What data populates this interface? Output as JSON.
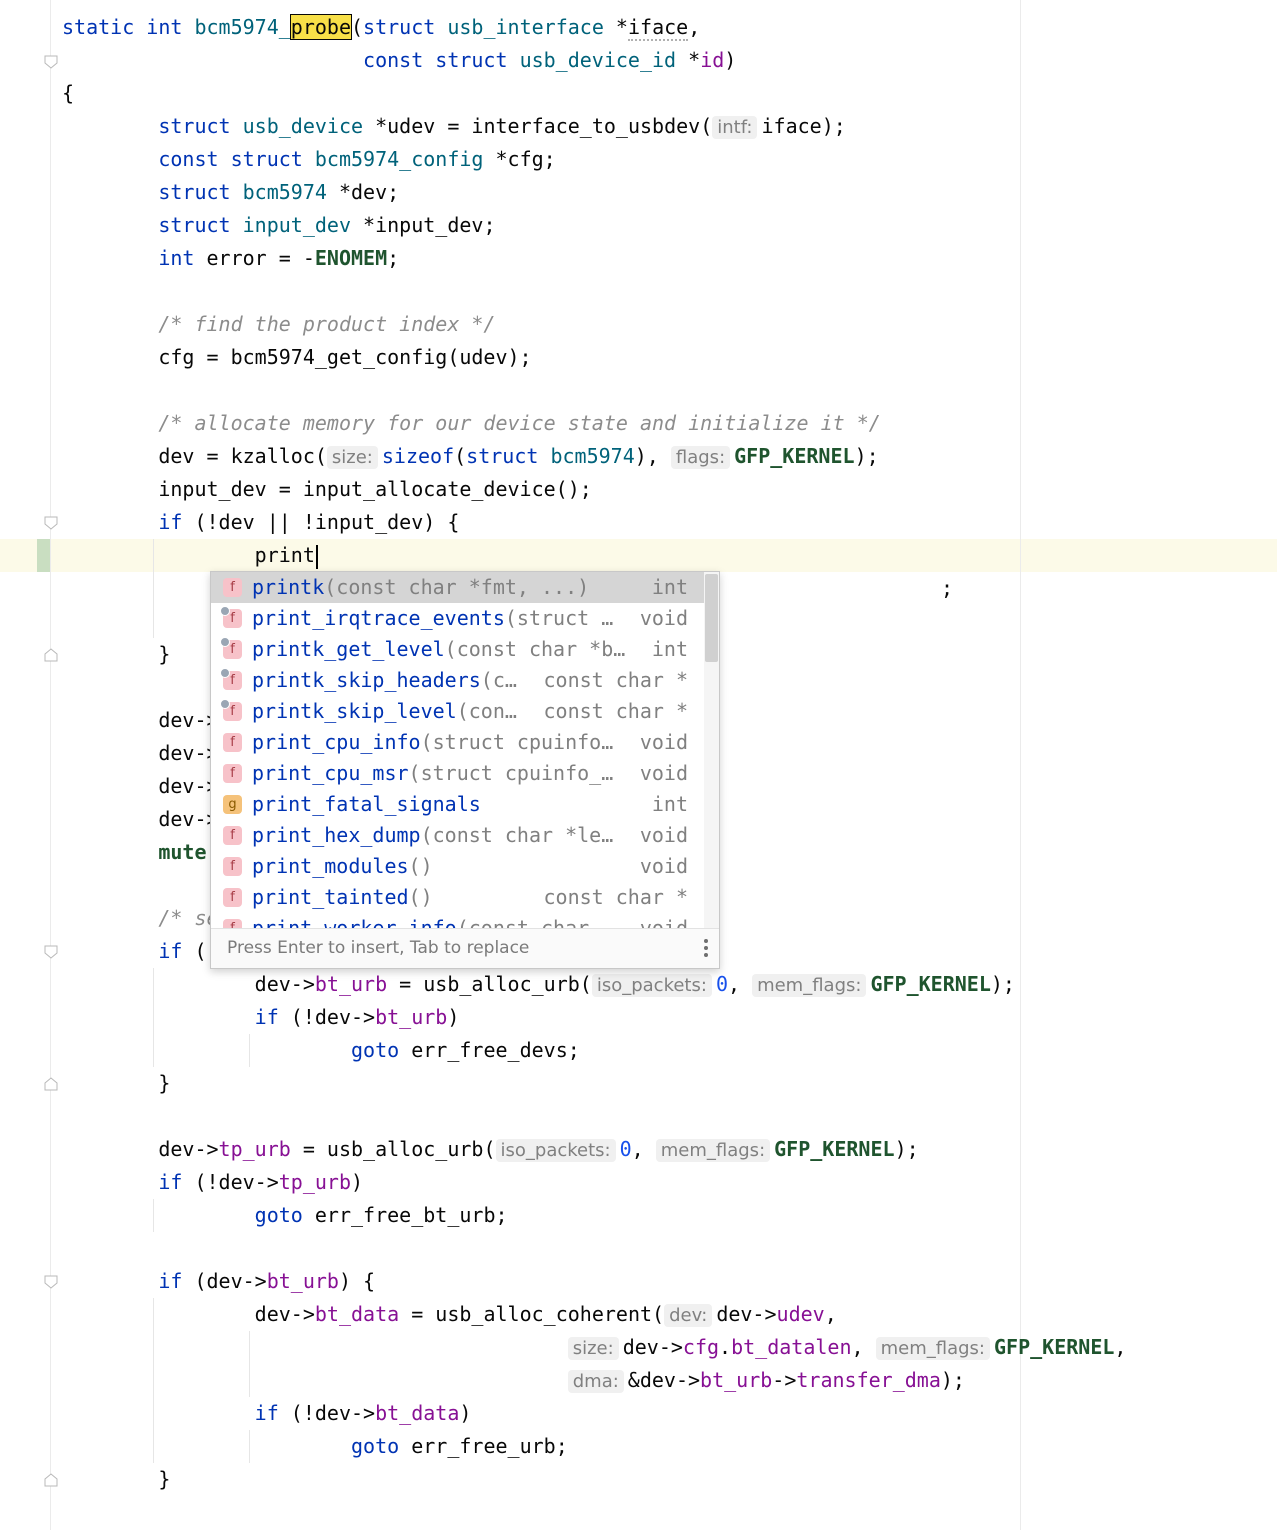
{
  "lines": [
    [
      {
        "t": "static int ",
        "c": "kw"
      },
      {
        "t": "bcm5974_",
        "c": "ty"
      },
      {
        "t": "probe",
        "c": "hl"
      },
      {
        "t": "(",
        "c": ""
      },
      {
        "t": "struct ",
        "c": "kw"
      },
      {
        "t": "usb_interface",
        "c": "ty"
      },
      {
        "t": " *",
        "c": ""
      },
      {
        "t": "iface",
        "c": "squig"
      },
      {
        "t": ",",
        "c": ""
      }
    ],
    [
      {
        "t": "                         const struct ",
        "c": "kw"
      },
      {
        "t": "usb_device_id",
        "c": "ty"
      },
      {
        "t": " *",
        "c": ""
      },
      {
        "t": "id",
        "c": "fld"
      },
      {
        "t": ")",
        "c": ""
      }
    ],
    [
      {
        "t": "{",
        "c": ""
      }
    ],
    [
      {
        "t": "        struct ",
        "c": "kw"
      },
      {
        "t": "usb_device",
        "c": "ty"
      },
      {
        "t": " *udev = interface_to_usbdev(",
        "c": ""
      },
      {
        "t": "intf:",
        "c": "hint"
      },
      {
        "t": "iface);",
        "c": ""
      }
    ],
    [
      {
        "t": "        const struct ",
        "c": "kw"
      },
      {
        "t": "bcm5974_config",
        "c": "ty"
      },
      {
        "t": " *cfg;",
        "c": ""
      }
    ],
    [
      {
        "t": "        struct ",
        "c": "kw"
      },
      {
        "t": "bcm5974",
        "c": "ty"
      },
      {
        "t": " *dev;",
        "c": ""
      }
    ],
    [
      {
        "t": "        struct ",
        "c": "kw"
      },
      {
        "t": "input_dev",
        "c": "ty"
      },
      {
        "t": " *input_dev;",
        "c": ""
      }
    ],
    [
      {
        "t": "        int ",
        "c": "kw"
      },
      {
        "t": "error = -",
        "c": ""
      },
      {
        "t": "ENOMEM",
        "c": "mc"
      },
      {
        "t": ";",
        "c": ""
      }
    ],
    [],
    [
      {
        "t": "        /* find the product index */",
        "c": "cm"
      }
    ],
    [
      {
        "t": "        cfg = bcm5974_get_config(udev);",
        "c": ""
      }
    ],
    [],
    [
      {
        "t": "        /* allocate memory for our device state and initialize it */",
        "c": "cm"
      }
    ],
    [
      {
        "t": "        dev = kzalloc(",
        "c": ""
      },
      {
        "t": "size:",
        "c": "hint"
      },
      {
        "t": "sizeof",
        "c": "kw"
      },
      {
        "t": "(",
        "c": ""
      },
      {
        "t": "struct ",
        "c": "kw"
      },
      {
        "t": "bcm5974",
        "c": "ty"
      },
      {
        "t": "), ",
        "c": ""
      },
      {
        "t": "flags:",
        "c": "hint"
      },
      {
        "t": "GFP_KERNEL",
        "c": "mc"
      },
      {
        "t": ");",
        "c": ""
      }
    ],
    [
      {
        "t": "        input_dev = input_allocate_device();",
        "c": ""
      }
    ],
    [
      {
        "t": "        if ",
        "c": "kw"
      },
      {
        "t": "(!dev || !input_dev) {",
        "c": ""
      }
    ],
    [
      {
        "t": "                print",
        "c": ""
      },
      {
        "t": "",
        "c": "caret"
      }
    ],
    [
      {
        "t": "                                                                         ;",
        "c": ""
      }
    ],
    [],
    [
      {
        "t": "        }",
        "c": ""
      }
    ],
    [],
    [
      {
        "t": "        dev->",
        "c": ""
      }
    ],
    [
      {
        "t": "        dev->",
        "c": ""
      }
    ],
    [
      {
        "t": "        dev->",
        "c": ""
      }
    ],
    [
      {
        "t": "        dev->",
        "c": ""
      }
    ],
    [
      {
        "t": "        mute",
        "c": "mc"
      }
    ],
    [],
    [
      {
        "t": "        /* se",
        "c": "cm"
      }
    ],
    [
      {
        "t": "        if ",
        "c": "kw"
      },
      {
        "t": "(",
        "c": ""
      }
    ],
    [
      {
        "t": "                dev->",
        "c": ""
      },
      {
        "t": "bt_urb",
        "c": "fld"
      },
      {
        "t": " = usb_alloc_urb(",
        "c": ""
      },
      {
        "t": "iso_packets:",
        "c": "hint"
      },
      {
        "t": "0",
        "c": "num"
      },
      {
        "t": ", ",
        "c": ""
      },
      {
        "t": "mem_flags:",
        "c": "hint"
      },
      {
        "t": "GFP_KERNEL",
        "c": "mc"
      },
      {
        "t": ");",
        "c": ""
      }
    ],
    [
      {
        "t": "                if ",
        "c": "kw"
      },
      {
        "t": "(!dev->",
        "c": ""
      },
      {
        "t": "bt_urb",
        "c": "fld"
      },
      {
        "t": ")",
        "c": ""
      }
    ],
    [
      {
        "t": "                        goto ",
        "c": "kw"
      },
      {
        "t": "err_free_devs;",
        "c": ""
      }
    ],
    [
      {
        "t": "        }",
        "c": ""
      }
    ],
    [],
    [
      {
        "t": "        dev->",
        "c": ""
      },
      {
        "t": "tp_urb",
        "c": "fld"
      },
      {
        "t": " = usb_alloc_urb(",
        "c": ""
      },
      {
        "t": "iso_packets:",
        "c": "hint"
      },
      {
        "t": "0",
        "c": "num"
      },
      {
        "t": ", ",
        "c": ""
      },
      {
        "t": "mem_flags:",
        "c": "hint"
      },
      {
        "t": "GFP_KERNEL",
        "c": "mc"
      },
      {
        "t": ");",
        "c": ""
      }
    ],
    [
      {
        "t": "        if ",
        "c": "kw"
      },
      {
        "t": "(!dev->",
        "c": ""
      },
      {
        "t": "tp_urb",
        "c": "fld"
      },
      {
        "t": ")",
        "c": ""
      }
    ],
    [
      {
        "t": "                goto ",
        "c": "kw"
      },
      {
        "t": "err_free_bt_urb;",
        "c": ""
      }
    ],
    [],
    [
      {
        "t": "        if ",
        "c": "kw"
      },
      {
        "t": "(dev->",
        "c": ""
      },
      {
        "t": "bt_urb",
        "c": "fld"
      },
      {
        "t": ") {",
        "c": ""
      }
    ],
    [
      {
        "t": "                dev->",
        "c": ""
      },
      {
        "t": "bt_data",
        "c": "fld"
      },
      {
        "t": " = usb_alloc_coherent(",
        "c": ""
      },
      {
        "t": "dev:",
        "c": "hint"
      },
      {
        "t": "dev->",
        "c": ""
      },
      {
        "t": "udev",
        "c": "fld"
      },
      {
        "t": ",",
        "c": ""
      }
    ],
    [
      {
        "t": "                                          ",
        "c": ""
      },
      {
        "t": "size:",
        "c": "hint"
      },
      {
        "t": "dev->",
        "c": ""
      },
      {
        "t": "cfg",
        "c": "fld"
      },
      {
        "t": ".",
        "c": ""
      },
      {
        "t": "bt_datalen",
        "c": "fld"
      },
      {
        "t": ", ",
        "c": ""
      },
      {
        "t": "mem_flags:",
        "c": "hint"
      },
      {
        "t": "GFP_KERNEL",
        "c": "mc"
      },
      {
        "t": ",",
        "c": ""
      }
    ],
    [
      {
        "t": "                                          ",
        "c": ""
      },
      {
        "t": "dma:",
        "c": "hint"
      },
      {
        "t": "&dev->",
        "c": ""
      },
      {
        "t": "bt_urb",
        "c": "fld"
      },
      {
        "t": "->",
        "c": ""
      },
      {
        "t": "transfer_dma",
        "c": "fld"
      },
      {
        "t": ");",
        "c": ""
      }
    ],
    [
      {
        "t": "                if ",
        "c": "kw"
      },
      {
        "t": "(!dev->",
        "c": ""
      },
      {
        "t": "bt_data",
        "c": "fld"
      },
      {
        "t": ")",
        "c": ""
      }
    ],
    [
      {
        "t": "                        goto ",
        "c": "kw"
      },
      {
        "t": "err_free_urb;",
        "c": ""
      }
    ],
    [
      {
        "t": "        }",
        "c": ""
      }
    ]
  ],
  "completion": {
    "items": [
      {
        "name": "printk",
        "typed": "print",
        "sig": "(const char *fmt, ...)",
        "ret": "int",
        "icon": "f",
        "selected": true
      },
      {
        "name": "print_irqtrace_events",
        "typed": "print",
        "sig": "(struct …",
        "ret": "void",
        "icon": "f",
        "locked": true
      },
      {
        "name": "printk_get_level",
        "typed": "print",
        "sig": "(const char *b…",
        "ret": "int",
        "icon": "f",
        "locked": true
      },
      {
        "name": "printk_skip_headers",
        "typed": "print",
        "sig": "(c…",
        "ret": "const char *",
        "icon": "f",
        "locked": true
      },
      {
        "name": "printk_skip_level",
        "typed": "print",
        "sig": "(con…",
        "ret": "const char *",
        "icon": "f",
        "locked": true
      },
      {
        "name": "print_cpu_info",
        "typed": "print",
        "sig": "(struct cpuinfo…",
        "ret": "void",
        "icon": "f"
      },
      {
        "name": "print_cpu_msr",
        "typed": "print",
        "sig": "(struct cpuinfo_…",
        "ret": "void",
        "icon": "f"
      },
      {
        "name": "print_fatal_signals",
        "typed": "print",
        "sig": "",
        "ret": "int",
        "icon": "g"
      },
      {
        "name": "print_hex_dump",
        "typed": "print",
        "sig": "(const char *le…",
        "ret": "void",
        "icon": "f"
      },
      {
        "name": "print_modules",
        "typed": "print",
        "sig": "()",
        "ret": "void",
        "icon": "f"
      },
      {
        "name": "print_tainted",
        "typed": "print",
        "sig": "()",
        "ret": "const char *",
        "icon": "f"
      },
      {
        "name": "print_worker_info",
        "typed": "print",
        "sig": "(const char…",
        "ret": "void",
        "icon": "f"
      }
    ],
    "footer": "Press Enter to insert, Tab to replace"
  },
  "colors": {
    "keyword": "#0033b3",
    "type": "#00627a",
    "macro": "#1f542e",
    "field": "#871094",
    "comment": "#8c8c8c",
    "highlight": "#f8e048"
  }
}
